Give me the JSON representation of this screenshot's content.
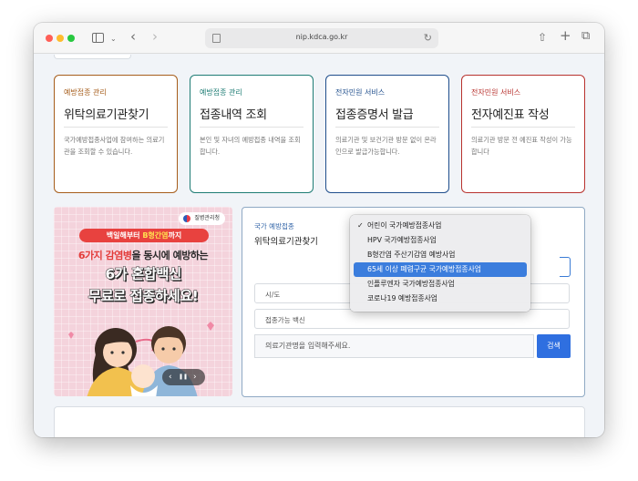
{
  "browser": {
    "url": "nip.kdca.go.kr"
  },
  "cards": [
    {
      "category": "예방접종 관리",
      "title": "위탁의료기관찾기",
      "desc": "국가예방접종사업에 참여하는 의료기관을 조회할 수 있습니다.",
      "color": "#a65d1b"
    },
    {
      "category": "예방접종 관리",
      "title": "접종내역 조회",
      "desc": "본인 및 자녀의 예방접종 내역을 조회합니다.",
      "color": "#1e7c74"
    },
    {
      "category": "전자민원 서비스",
      "title": "접종증명서 발급",
      "desc": "의료기관 및 보건기관 방문 없이 온라인으로 발급가능합니다.",
      "color": "#1f4e8c"
    },
    {
      "category": "전자민원 서비스",
      "title": "전자예진표 작성",
      "desc": "의료기관 방문 전 예진표 작성이 가능합니다",
      "color": "#b8322e"
    }
  ],
  "banner": {
    "logo": "질병관리청",
    "pill_a": "백일해부터 ",
    "pill_b": "B형간염",
    "pill_c": "까지",
    "line1_a": "6가지 감염병",
    "line1_b": "을 동시에 예방하는",
    "line2": "6가 혼합백신",
    "line3": "무료로 접종하세요!",
    "prev": "‹",
    "pause": "❚❚",
    "next": "›"
  },
  "search": {
    "category": "국가 예방접종",
    "title": "위탁의료기관찾기",
    "region_label": "시/도",
    "vaccine_label": "접종가능 백신",
    "name_placeholder": "의료기관명을 입력해주세요.",
    "search_button": "검색"
  },
  "dropdown": {
    "check": "✓",
    "selected_index": 0,
    "highlighted_index": 3,
    "options": [
      "어린이 국가예방접종사업",
      "HPV 국가예방접종사업",
      "B형간염 주산기감염 예방사업",
      "65세 이상 폐렴구균 국가예방접종사업",
      "인플루엔자 국가예방접종사업",
      "코로나19 예방접종사업"
    ]
  }
}
